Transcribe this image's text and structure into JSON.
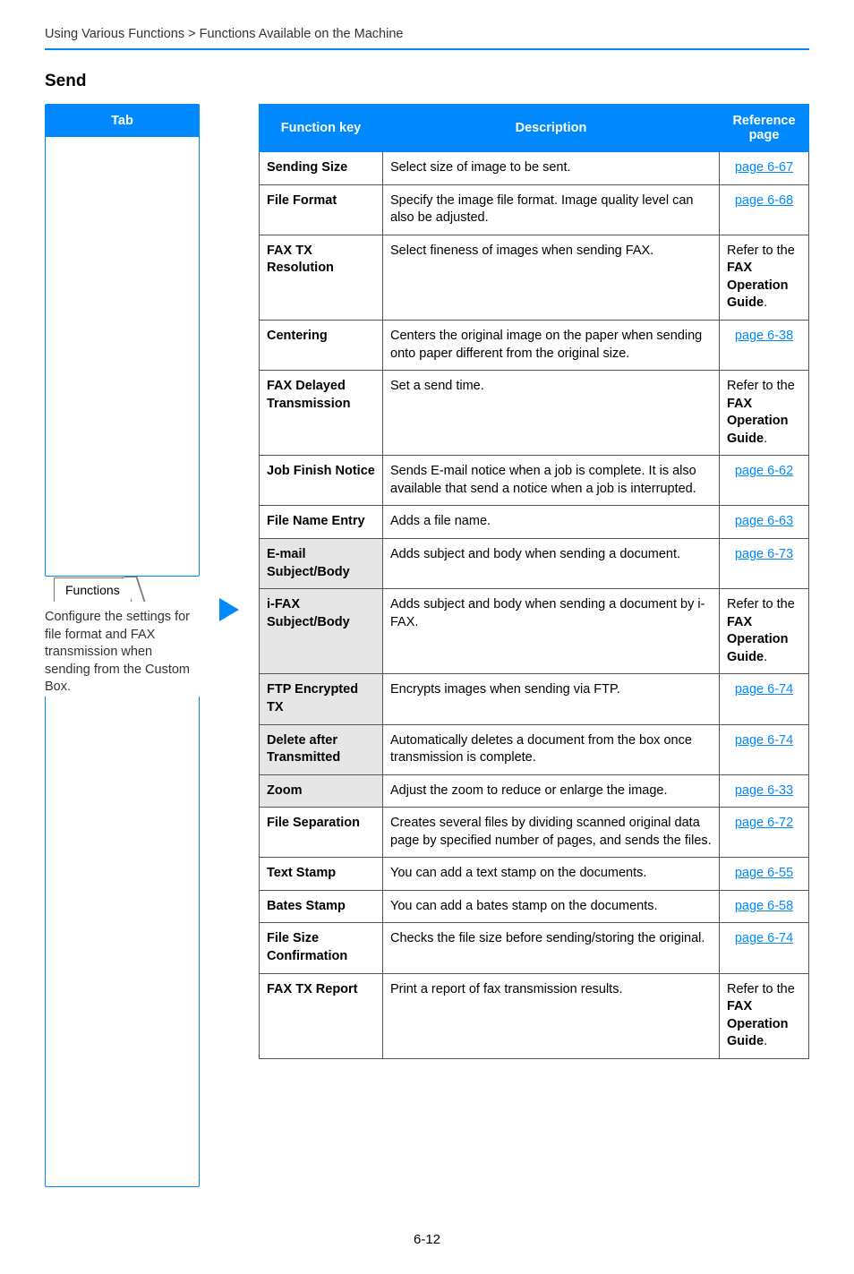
{
  "breadcrumb": "Using Various Functions > Functions Available on the Machine",
  "section_title": "Send",
  "tab": {
    "header": "Tab",
    "chip": "Functions",
    "desc": "Configure the settings for file format and FAX transmission when sending from the Custom Box."
  },
  "table": {
    "headers": {
      "fk": "Function key",
      "desc": "Description",
      "ref": "Reference page"
    },
    "rows": [
      {
        "fk": "Sending Size",
        "desc": "Select size of image to be sent.",
        "ref_link": "page 6-67"
      },
      {
        "fk": "File Format",
        "desc": "Specify the image file format. Image quality level can also be adjusted.",
        "ref_link": "page 6-68"
      },
      {
        "fk": "FAX TX Resolution",
        "desc": "Select fineness of images when sending FAX.",
        "ref_guide": true
      },
      {
        "fk": "Centering",
        "desc": "Centers the original image on the paper when sending onto paper different from the original size.",
        "ref_link": "page 6-38"
      },
      {
        "fk": "FAX Delayed Transmission",
        "desc": "Set a send time.",
        "ref_guide": true
      },
      {
        "fk": "Job Finish Notice",
        "desc": "Sends E-mail notice when a job is complete. It is also available that send a notice when a job is interrupted.",
        "ref_link": "page 6-62"
      },
      {
        "fk": "File Name Entry",
        "desc": "Adds a file name.",
        "ref_link": "page 6-63"
      },
      {
        "fk": "E-mail Subject/Body",
        "gray": true,
        "desc": "Adds subject and body when sending a document.",
        "ref_link": "page 6-73"
      },
      {
        "fk": "i-FAX Subject/Body",
        "gray": true,
        "desc": "Adds subject and body when sending a document by i-FAX.",
        "ref_guide": true
      },
      {
        "fk": "FTP Encrypted TX",
        "gray": true,
        "desc": "Encrypts images when sending via FTP.",
        "ref_link": "page 6-74"
      },
      {
        "fk": "Delete after Transmitted",
        "gray": true,
        "desc": "Automatically deletes a document from the box once transmission is complete.",
        "ref_link": "page 6-74"
      },
      {
        "fk": "Zoom",
        "gray": true,
        "desc": "Adjust the zoom to reduce or enlarge the image.",
        "ref_link": "page 6-33"
      },
      {
        "fk": "File Separation",
        "desc": "Creates several files by dividing scanned original data page by specified number of pages, and sends the files.",
        "ref_link": "page 6-72"
      },
      {
        "fk": "Text Stamp",
        "desc": "You can add a text stamp on the documents.",
        "ref_link": "page 6-55"
      },
      {
        "fk": "Bates Stamp",
        "desc": "You can add a bates stamp on the documents.",
        "ref_link": "page 6-58"
      },
      {
        "fk": "File Size Confirmation",
        "desc": "Checks the file size before sending/storing the original.",
        "ref_link": "page 6-74"
      },
      {
        "fk": "FAX TX Report",
        "desc": "Print a report of fax transmission results.",
        "ref_guide": true
      }
    ],
    "guide_ref": {
      "line1": "Refer to the ",
      "line2": "FAX Operation Guide",
      "suffix": "."
    }
  },
  "page_number": "6-12"
}
